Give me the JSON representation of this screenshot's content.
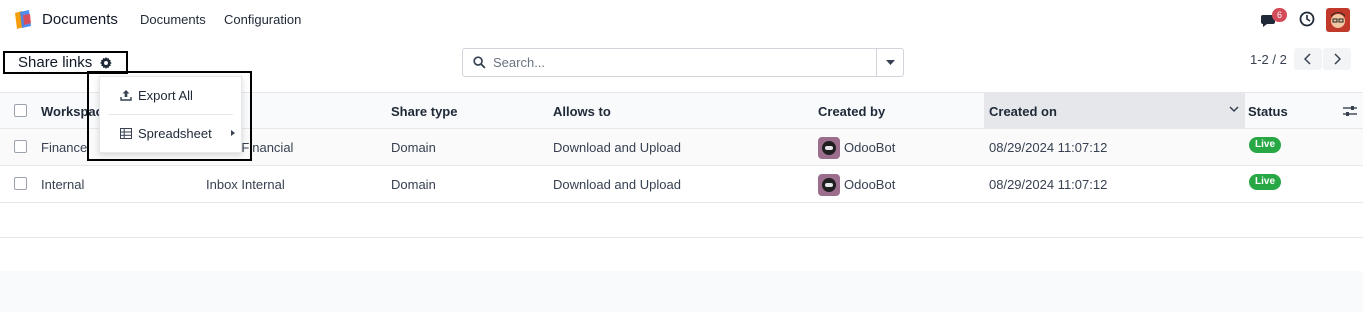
{
  "app": {
    "title": "Documents"
  },
  "nav": {
    "menu": [
      "Documents",
      "Configuration"
    ],
    "chat_count": "6"
  },
  "breadcrumb": {
    "title": "Share links"
  },
  "search": {
    "placeholder": "Search..."
  },
  "pager": {
    "value": "1-2 / 2"
  },
  "table": {
    "columns": [
      "Workspace",
      "Share type",
      "Allows to",
      "Created by",
      "Created on",
      "Status"
    ],
    "rows": [
      {
        "workspace": "Finance",
        "name": "Inbox Financial",
        "share_type": "Domain",
        "allows_to": "Download and Upload",
        "created_by": "OdooBot",
        "created_on": "08/29/2024 11:07:12",
        "status": "Live"
      },
      {
        "workspace": "Internal",
        "name": "Inbox Internal",
        "share_type": "Domain",
        "allows_to": "Download and Upload",
        "created_by": "OdooBot",
        "created_on": "08/29/2024 11:07:12",
        "status": "Live"
      }
    ]
  },
  "dropdown": {
    "export_all": "Export All",
    "spreadsheet": "Spreadsheet"
  },
  "colors": {
    "accent": "#714B67",
    "live": "#28a745",
    "badge": "#d44c59"
  }
}
